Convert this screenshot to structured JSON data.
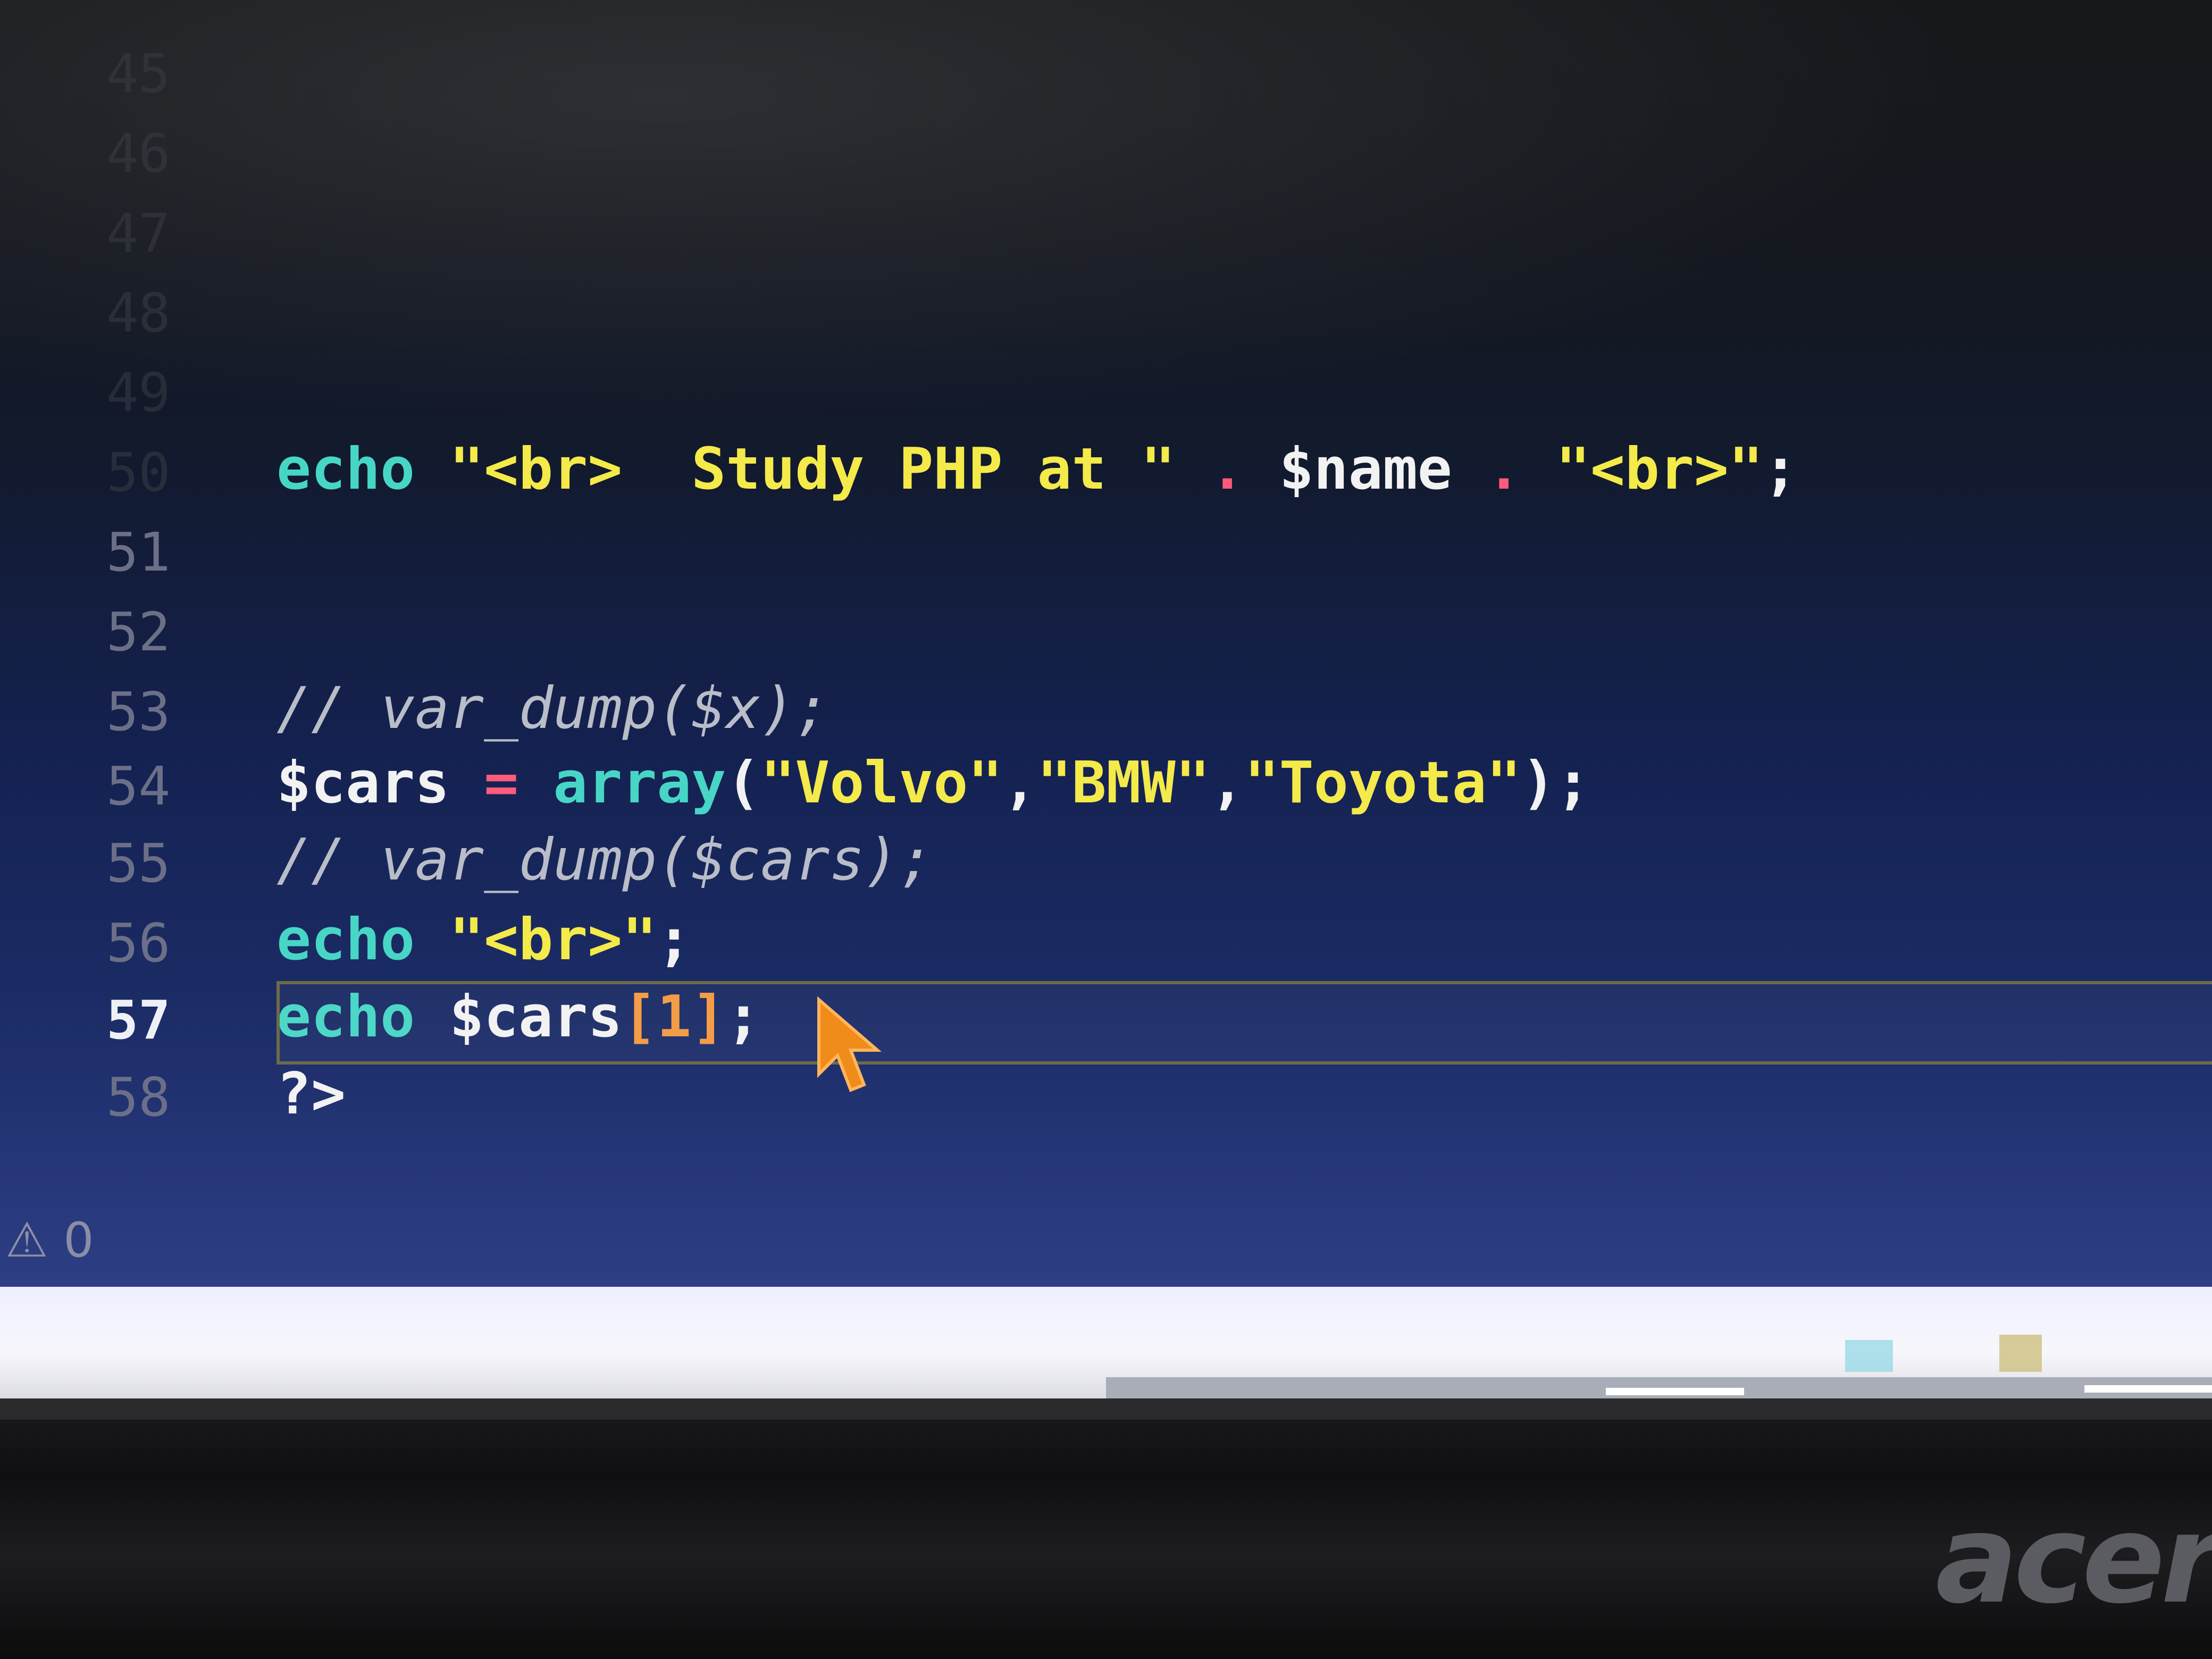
{
  "editor": {
    "ghost_line_numbers": [
      "45",
      "46",
      "47",
      "48",
      "49",
      "50"
    ],
    "lines": [
      {
        "number": "",
        "tokens": [
          {
            "t": "echo",
            "c": "kw"
          },
          {
            "t": " ",
            "c": "var"
          },
          {
            "t": "\"<br>  Study PHP at \"",
            "c": "str"
          },
          {
            "t": " . ",
            "c": "op"
          },
          {
            "t": "$name",
            "c": "var"
          },
          {
            "t": " . ",
            "c": "op"
          },
          {
            "t": "\"<br>\"",
            "c": "str"
          },
          {
            "t": ";",
            "c": "punc"
          }
        ]
      },
      {
        "number": "51",
        "tokens": []
      },
      {
        "number": "52",
        "tokens": []
      },
      {
        "number": "53",
        "tokens": [
          {
            "t": "// var_dump($x);",
            "c": "cm"
          }
        ]
      },
      {
        "number": "54",
        "tokens": [
          {
            "t": "$cars",
            "c": "var"
          },
          {
            "t": " = ",
            "c": "op"
          },
          {
            "t": "array",
            "c": "kw"
          },
          {
            "t": "(",
            "c": "punc"
          },
          {
            "t": "\"Volvo\"",
            "c": "str"
          },
          {
            "t": ",",
            "c": "punc"
          },
          {
            "t": "\"BMW\"",
            "c": "str"
          },
          {
            "t": ",",
            "c": "punc"
          },
          {
            "t": "\"Toyota\"",
            "c": "str"
          },
          {
            "t": ");",
            "c": "punc"
          }
        ]
      },
      {
        "number": "55",
        "tokens": [
          {
            "t": "// var_dump($cars);",
            "c": "cm"
          }
        ]
      },
      {
        "number": "56",
        "tokens": [
          {
            "t": "echo",
            "c": "kw"
          },
          {
            "t": " ",
            "c": "var"
          },
          {
            "t": "\"<br>\"",
            "c": "str"
          },
          {
            "t": ";",
            "c": "punc"
          }
        ]
      },
      {
        "number": "57",
        "active": true,
        "tokens": [
          {
            "t": "echo",
            "c": "kw"
          },
          {
            "t": " ",
            "c": "var"
          },
          {
            "t": "$cars",
            "c": "var"
          },
          {
            "t": "[",
            "c": "br"
          },
          {
            "t": "1",
            "c": "num"
          },
          {
            "t": "]",
            "c": "br"
          },
          {
            "t": ";",
            "c": "punc"
          }
        ]
      },
      {
        "number": "58",
        "tokens": [
          {
            "t": "?>",
            "c": "var"
          }
        ]
      }
    ]
  },
  "status": {
    "warning_icon": "warning-triangle-icon",
    "warning_count": "0"
  },
  "monitor": {
    "brand": "acer"
  },
  "colors": {
    "keyword": "#47d6c6",
    "string": "#f4ea4a",
    "operator": "#ff5b7a",
    "comment": "#b9bdc8",
    "number": "#f39a40",
    "current_line_border": "#6c6a4a"
  }
}
